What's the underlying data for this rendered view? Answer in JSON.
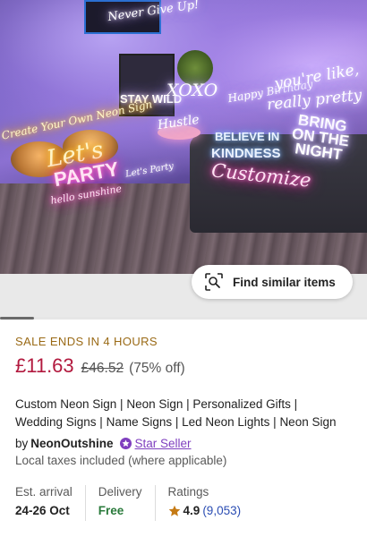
{
  "hero": {
    "neon_signs": {
      "never_give_up": "Never Give Up!",
      "stay_wild": "STAY WILD",
      "xoxo": "XOXO",
      "happy_birthday": "Happy Birthday",
      "youre_like": "you're like,",
      "really_pretty": "really pretty",
      "create_your_own": "Create Your Own Neon Sign",
      "hustle": "Hustle",
      "lets": "Let's",
      "party": "PARTY",
      "hello_sunshine": "hello sunshine",
      "believe_in": "BELIEVE IN",
      "kindness": "KINDNESS",
      "bring_on_the_night": "BRING ON THE NIGHT",
      "customize": "Customize",
      "lets_party_small": "Let's Party"
    },
    "find_similar_label": "Find similar items"
  },
  "listing": {
    "sale_text": "SALE ENDS IN 4 HOURS",
    "price": "£11.63",
    "original_price": "£46.52",
    "discount": "(75% off)",
    "title_line1": "Custom Neon Sign | Neon Sign | Personalized Gifts |",
    "title_line2": "Wedding Signs | Name Signs  |  Led Neon Lights | Neon Sign",
    "seller_prefix": "by",
    "shop_name": "NeonOutshine",
    "star_seller_label": "Star Seller",
    "taxes_note": "Local taxes included (where applicable)"
  },
  "info": {
    "arrival_label": "Est. arrival",
    "arrival_value": "24-26 Oct",
    "delivery_label": "Delivery",
    "delivery_value": "Free",
    "ratings_label": "Ratings",
    "rating_value": "4.9",
    "rating_count": "(9,053)"
  },
  "colors": {
    "sale": "#9a6a16",
    "price": "#b2193e",
    "star_seller": "#7f3fbf",
    "free_delivery": "#2a7a3b",
    "rating_count": "#2b4db3",
    "rating_star": "#c57a14"
  },
  "icons": {
    "find_similar": "visual-search-icon",
    "star_seller": "star-seller-badge-icon",
    "rating": "star-icon"
  }
}
